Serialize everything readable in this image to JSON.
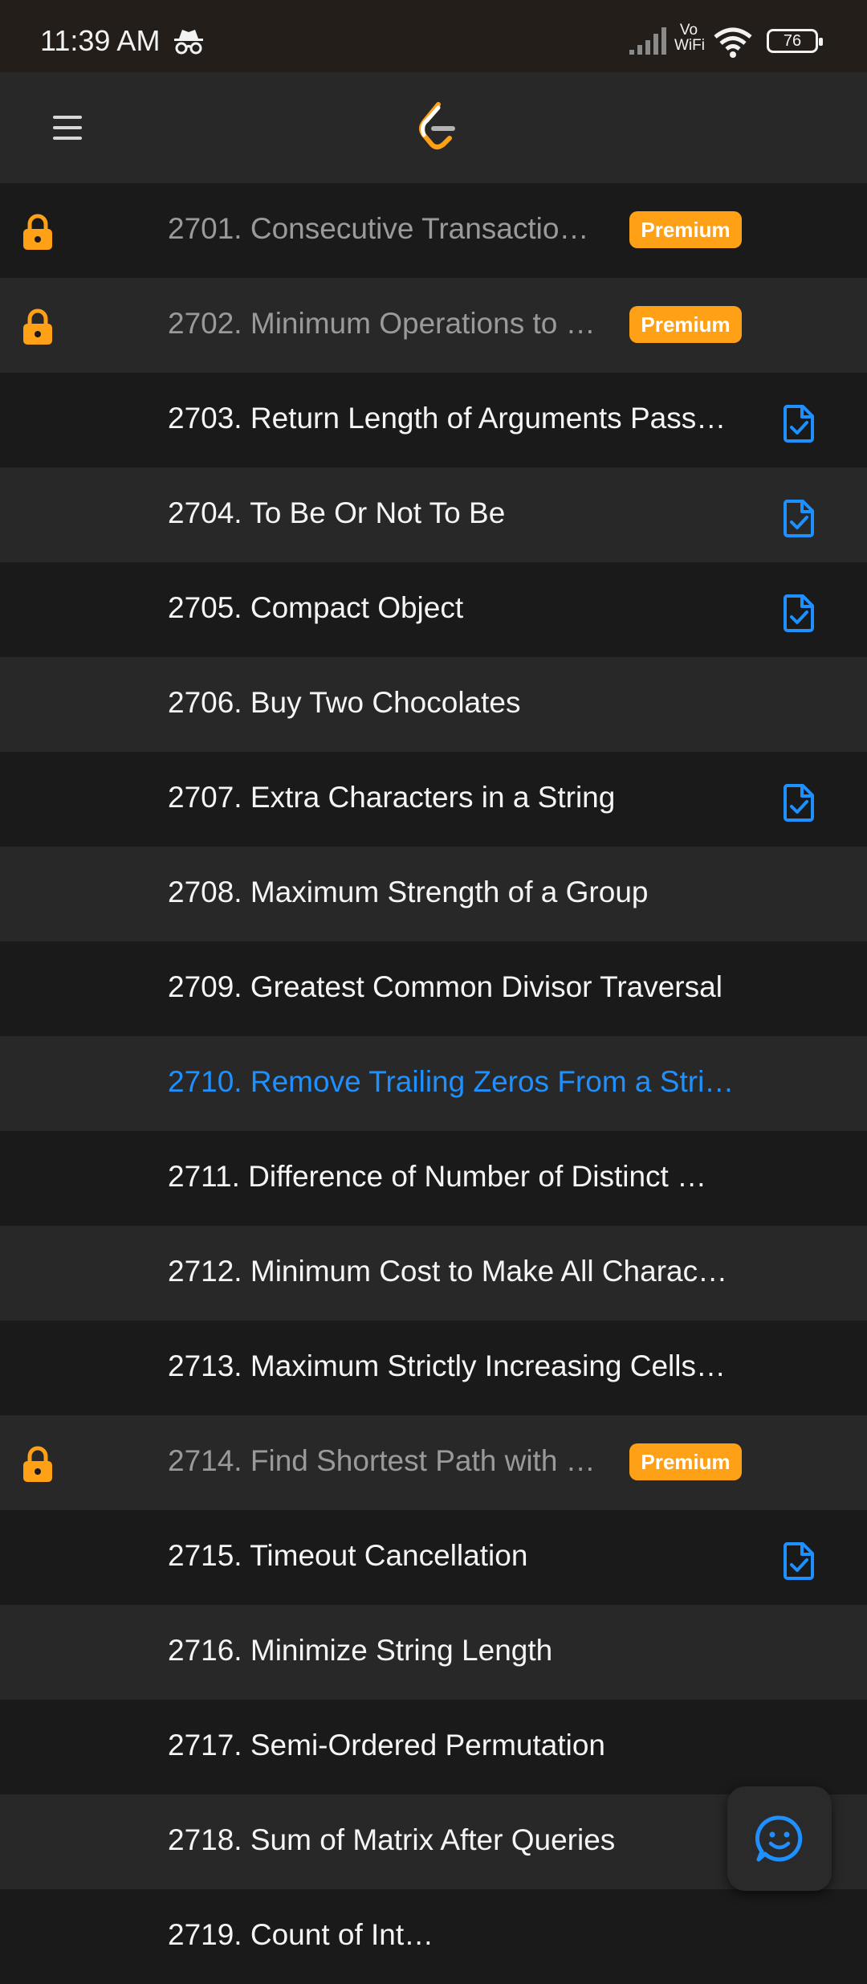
{
  "status_bar": {
    "time": "11:39 AM",
    "network_label_top": "Vo",
    "network_label_bottom": "WiFi",
    "battery": "76"
  },
  "app_bar": {
    "menu_icon": "hamburger-menu-icon",
    "logo": "leetcode-logo"
  },
  "colors": {
    "premium": "#ffa116",
    "active": "#1e90ff",
    "solved_icon": "#1e90ff",
    "lock": "#ffa116"
  },
  "problems": [
    {
      "title": "2701. Consecutive Transactio…",
      "locked": true,
      "premium_label": "Premium"
    },
    {
      "title": "2702. Minimum Operations to …",
      "locked": true,
      "premium_label": "Premium"
    },
    {
      "title": "2703. Return Length of Arguments Pass…",
      "solved": true
    },
    {
      "title": "2704. To Be Or Not To Be",
      "solved": true
    },
    {
      "title": "2705. Compact Object",
      "solved": true
    },
    {
      "title": "2706. Buy Two Chocolates"
    },
    {
      "title": "2707. Extra Characters in a String",
      "solved": true
    },
    {
      "title": "2708. Maximum Strength of a Group"
    },
    {
      "title": "2709. Greatest Common Divisor Traversal"
    },
    {
      "title": "2710. Remove Trailing Zeros From a Stri…",
      "active": true
    },
    {
      "title": "2711. Difference of Number of Distinct …"
    },
    {
      "title": "2712. Minimum Cost to Make All Charac…"
    },
    {
      "title": "2713. Maximum Strictly Increasing Cells…"
    },
    {
      "title": "2714. Find Shortest Path with …",
      "locked": true,
      "premium_label": "Premium"
    },
    {
      "title": "2715. Timeout Cancellation",
      "solved": true
    },
    {
      "title": "2716. Minimize String Length"
    },
    {
      "title": "2717. Semi-Ordered Permutation"
    },
    {
      "title": "2718. Sum of Matrix After Queries"
    },
    {
      "title": "2719. Count of Int…"
    }
  ],
  "fab": {
    "icon": "smiley-feedback-icon"
  }
}
